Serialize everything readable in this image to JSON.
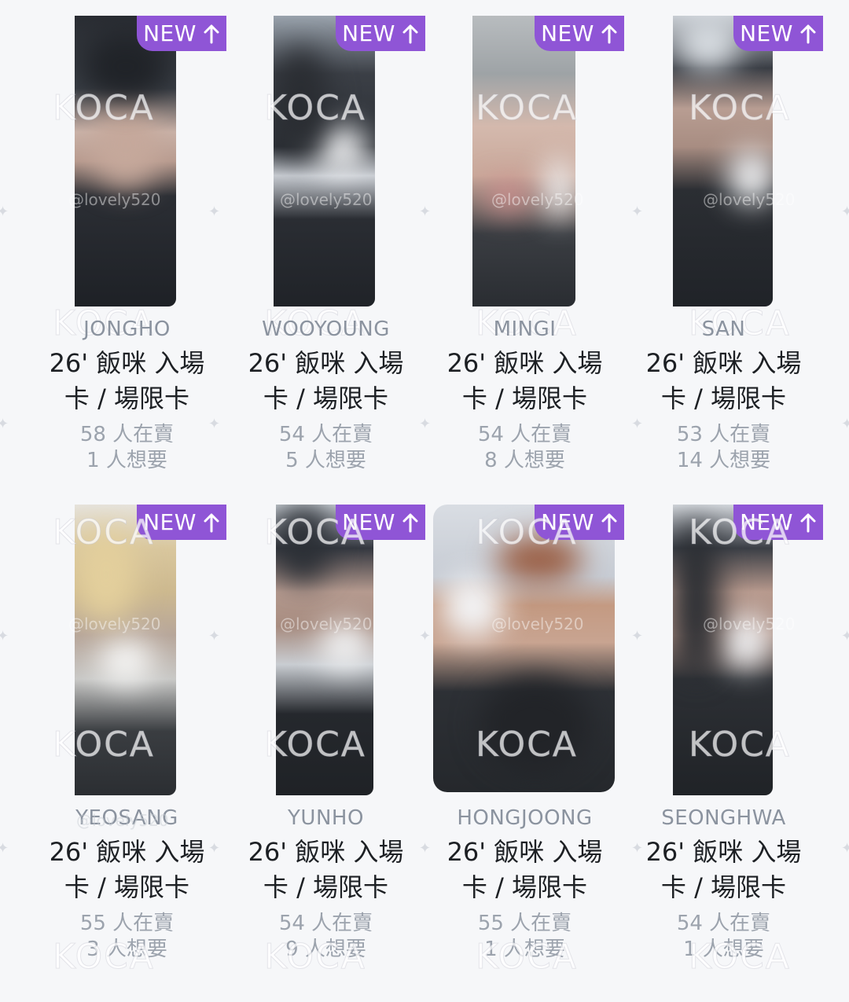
{
  "badge_label": "NEW",
  "badge_color": "#8f55d6",
  "watermark_text": "KOCA",
  "handle_text": "@lovely520",
  "cards": [
    {
      "member": "JONGHO",
      "title_line1": "26' 飯咪 入場",
      "title_line2": "卡 / 場限卡",
      "sellers": "58 人在賣",
      "wants": "1 人想要"
    },
    {
      "member": "WOOYOUNG",
      "title_line1": "26' 飯咪 入場",
      "title_line2": "卡 / 場限卡",
      "sellers": "54 人在賣",
      "wants": "5 人想要"
    },
    {
      "member": "MINGI",
      "title_line1": "26' 飯咪 入場",
      "title_line2": "卡 / 場限卡",
      "sellers": "54 人在賣",
      "wants": "8 人想要"
    },
    {
      "member": "SAN",
      "title_line1": "26' 飯咪 入場",
      "title_line2": "卡 / 場限卡",
      "sellers": "53 人在賣",
      "wants": "14 人想要"
    },
    {
      "member": "YEOSANG",
      "title_line1": "26' 飯咪 入場",
      "title_line2": "卡 / 場限卡",
      "sellers": "55 人在賣",
      "wants": "3 人想要"
    },
    {
      "member": "YUNHO",
      "title_line1": "26' 飯咪 入場",
      "title_line2": "卡 / 場限卡",
      "sellers": "54 人在賣",
      "wants": "9 人想要"
    },
    {
      "member": "HONGJOONG",
      "title_line1": "26' 飯咪 入場",
      "title_line2": "卡 / 場限卡",
      "sellers": "55 人在賣",
      "wants": "1 人想要"
    },
    {
      "member": "SEONGHWA",
      "title_line1": "26' 飯咪 入場",
      "title_line2": "卡 / 場限卡",
      "sellers": "54 人在賣",
      "wants": "1 人想要"
    }
  ]
}
